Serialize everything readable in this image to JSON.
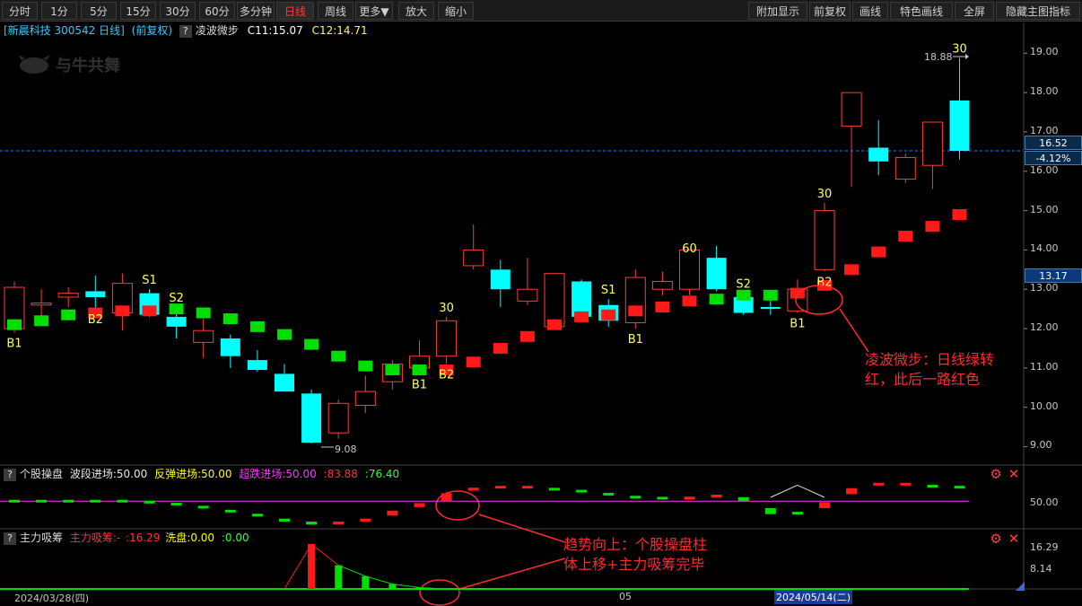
{
  "toolbar": {
    "left": [
      "分时",
      "1分",
      "5分",
      "15分",
      "30分",
      "60分",
      "多分钟",
      "日线",
      "周线",
      "更多▼",
      "放大",
      "缩小"
    ],
    "active": "日线",
    "right": [
      "附加显示",
      "前复权",
      "画线",
      "特色画线",
      "全屏",
      "隐藏主图指标"
    ]
  },
  "header": {
    "stock": "[新晨科技 300542 日线]",
    "adjust": "(前复权)",
    "indicator": "凌波微步",
    "c1": "C11:15.07",
    "c2": "C12:14.71"
  },
  "watermark": "与牛共舞",
  "price_axis": [
    "19.00",
    "18.00",
    "17.00",
    "16.00",
    "15.00",
    "14.00",
    "13.00",
    "12.00",
    "11.00",
    "10.00",
    "9.00"
  ],
  "price_tags": {
    "current": "16.52",
    "change": "-4.12%",
    "indicator": "13.17"
  },
  "markers": {
    "high": "18.88",
    "low": "9.08"
  },
  "chart_data": {
    "type": "candlestick",
    "y_range": [
      8.6,
      19.35
    ],
    "candles": [
      {
        "o": 12.0,
        "h": 13.2,
        "l": 11.9,
        "c": 13.05,
        "kind": "up"
      },
      {
        "o": 12.6,
        "h": 13.0,
        "l": 12.2,
        "c": 12.65,
        "kind": "up"
      },
      {
        "o": 12.8,
        "h": 13.05,
        "l": 12.55,
        "c": 12.9,
        "kind": "up"
      },
      {
        "o": 12.95,
        "h": 13.35,
        "l": 12.5,
        "c": 12.8,
        "kind": "down"
      },
      {
        "o": 12.4,
        "h": 13.4,
        "l": 11.95,
        "c": 13.15,
        "kind": "up"
      },
      {
        "o": 12.9,
        "h": 13.0,
        "l": 12.3,
        "c": 12.35,
        "kind": "down"
      },
      {
        "o": 12.3,
        "h": 12.55,
        "l": 11.75,
        "c": 12.05,
        "kind": "down"
      },
      {
        "o": 11.65,
        "h": 12.25,
        "l": 11.25,
        "c": 11.95,
        "kind": "up"
      },
      {
        "o": 11.75,
        "h": 11.85,
        "l": 11.0,
        "c": 11.3,
        "kind": "down"
      },
      {
        "o": 11.2,
        "h": 11.45,
        "l": 10.9,
        "c": 10.95,
        "kind": "down"
      },
      {
        "o": 10.85,
        "h": 11.1,
        "l": 10.4,
        "c": 10.4,
        "kind": "down"
      },
      {
        "o": 10.35,
        "h": 10.45,
        "l": 9.08,
        "c": 9.1,
        "kind": "down"
      },
      {
        "o": 9.35,
        "h": 10.2,
        "l": 9.2,
        "c": 10.1,
        "kind": "up"
      },
      {
        "o": 10.05,
        "h": 10.8,
        "l": 9.85,
        "c": 10.4,
        "kind": "up"
      },
      {
        "o": 10.65,
        "h": 11.2,
        "l": 10.45,
        "c": 11.1,
        "kind": "up"
      },
      {
        "o": 11.0,
        "h": 11.7,
        "l": 10.85,
        "c": 11.3,
        "kind": "up"
      },
      {
        "o": 11.3,
        "h": 12.3,
        "l": 11.1,
        "c": 12.2,
        "kind": "up"
      },
      {
        "o": 13.6,
        "h": 14.65,
        "l": 13.5,
        "c": 14.0,
        "kind": "up"
      },
      {
        "o": 13.5,
        "h": 13.75,
        "l": 12.55,
        "c": 13.0,
        "kind": "down"
      },
      {
        "o": 12.7,
        "h": 13.8,
        "l": 12.6,
        "c": 13.0,
        "kind": "up"
      },
      {
        "o": 12.05,
        "h": 13.4,
        "l": 12.05,
        "c": 13.4,
        "kind": "up"
      },
      {
        "o": 13.2,
        "h": 13.25,
        "l": 12.3,
        "c": 12.3,
        "kind": "down"
      },
      {
        "o": 12.6,
        "h": 12.75,
        "l": 12.05,
        "c": 12.2,
        "kind": "down"
      },
      {
        "o": 12.15,
        "h": 13.5,
        "l": 12.0,
        "c": 13.3,
        "kind": "up"
      },
      {
        "o": 13.0,
        "h": 13.45,
        "l": 12.85,
        "c": 13.2,
        "kind": "up"
      },
      {
        "o": 13.0,
        "h": 13.8,
        "l": 12.85,
        "c": 14.0,
        "kind": "up"
      },
      {
        "o": 13.8,
        "h": 14.1,
        "l": 12.95,
        "c": 13.0,
        "kind": "down"
      },
      {
        "o": 12.8,
        "h": 12.9,
        "l": 12.35,
        "c": 12.4,
        "kind": "down"
      },
      {
        "o": 12.55,
        "h": 12.9,
        "l": 12.35,
        "c": 12.5,
        "kind": "down"
      },
      {
        "o": 12.45,
        "h": 13.25,
        "l": 12.4,
        "c": 13.0,
        "kind": "up"
      },
      {
        "o": 13.5,
        "h": 15.2,
        "l": 13.45,
        "c": 15.0,
        "kind": "up"
      },
      {
        "o": 17.15,
        "h": 18.0,
        "l": 15.6,
        "c": 18.0,
        "kind": "up"
      },
      {
        "o": 16.6,
        "h": 17.3,
        "l": 15.9,
        "c": 16.25,
        "kind": "down"
      },
      {
        "o": 15.8,
        "h": 16.45,
        "l": 15.7,
        "c": 16.35,
        "kind": "up"
      },
      {
        "o": 16.15,
        "h": 17.25,
        "l": 15.55,
        "c": 17.25,
        "kind": "up"
      },
      {
        "o": 17.8,
        "h": 18.88,
        "l": 16.3,
        "c": 16.52,
        "kind": "down"
      }
    ],
    "step_line": [
      {
        "v": 12.1,
        "color": "green"
      },
      {
        "v": 12.2,
        "color": "green"
      },
      {
        "v": 12.35,
        "color": "green"
      },
      {
        "v": 12.4,
        "color": "red"
      },
      {
        "v": 12.45,
        "color": "red"
      },
      {
        "v": 12.45,
        "color": "red"
      },
      {
        "v": 12.5,
        "color": "green"
      },
      {
        "v": 12.4,
        "color": "green"
      },
      {
        "v": 12.25,
        "color": "green"
      },
      {
        "v": 12.05,
        "color": "green"
      },
      {
        "v": 11.85,
        "color": "green"
      },
      {
        "v": 11.6,
        "color": "green"
      },
      {
        "v": 11.3,
        "color": "green"
      },
      {
        "v": 11.05,
        "color": "green"
      },
      {
        "v": 10.95,
        "color": "green"
      },
      {
        "v": 10.95,
        "color": "green"
      },
      {
        "v": 10.95,
        "color": "red"
      },
      {
        "v": 11.15,
        "color": "red"
      },
      {
        "v": 11.5,
        "color": "red"
      },
      {
        "v": 11.8,
        "color": "red"
      },
      {
        "v": 12.1,
        "color": "red"
      },
      {
        "v": 12.3,
        "color": "red"
      },
      {
        "v": 12.35,
        "color": "red"
      },
      {
        "v": 12.45,
        "color": "red"
      },
      {
        "v": 12.55,
        "color": "red"
      },
      {
        "v": 12.7,
        "color": "red"
      },
      {
        "v": 12.75,
        "color": "green"
      },
      {
        "v": 12.85,
        "color": "green"
      },
      {
        "v": 12.85,
        "color": "green"
      },
      {
        "v": 12.9,
        "color": "red"
      },
      {
        "v": 13.1,
        "color": "red"
      },
      {
        "v": 13.5,
        "color": "red"
      },
      {
        "v": 13.95,
        "color": "red"
      },
      {
        "v": 14.35,
        "color": "red"
      },
      {
        "v": 14.6,
        "color": "red"
      },
      {
        "v": 14.9,
        "color": "red"
      }
    ],
    "signals": [
      {
        "i": 0,
        "text": "B1",
        "pos": "below"
      },
      {
        "i": 3,
        "text": "B2",
        "pos": "below"
      },
      {
        "i": 5,
        "text": "S1",
        "pos": "above"
      },
      {
        "i": 6,
        "text": "S2",
        "pos": "above"
      },
      {
        "i": 15,
        "text": "B1",
        "pos": "below"
      },
      {
        "i": 16,
        "text": "B2",
        "pos": "below"
      },
      {
        "i": 16,
        "text": "30",
        "pos": "above"
      },
      {
        "i": 22,
        "text": "S1",
        "pos": "above"
      },
      {
        "i": 23,
        "text": "B1",
        "pos": "below"
      },
      {
        "i": 25,
        "text": "60",
        "pos": "above"
      },
      {
        "i": 27,
        "text": "S2",
        "pos": "above"
      },
      {
        "i": 29,
        "text": "B1",
        "pos": "below"
      },
      {
        "i": 30,
        "text": "B2",
        "pos": "below"
      },
      {
        "i": 30,
        "text": "30",
        "pos": "above"
      },
      {
        "i": 35,
        "text": "30",
        "pos": "above"
      }
    ],
    "ind1": [
      {
        "v": 50,
        "d": 2,
        "c": "green"
      },
      {
        "v": 50,
        "d": 2,
        "c": "green"
      },
      {
        "v": 50,
        "d": 2,
        "c": "green"
      },
      {
        "v": 50,
        "d": 2,
        "c": "green"
      },
      {
        "v": 50,
        "d": 2,
        "c": "green"
      },
      {
        "v": 49,
        "d": 2,
        "c": "green"
      },
      {
        "v": 47,
        "d": 2,
        "c": "green"
      },
      {
        "v": 44,
        "d": 2,
        "c": "green"
      },
      {
        "v": 40,
        "d": 2,
        "c": "green"
      },
      {
        "v": 36,
        "d": 2,
        "c": "green"
      },
      {
        "v": 31,
        "d": 3,
        "c": "green"
      },
      {
        "v": 28,
        "d": 3,
        "c": "green"
      },
      {
        "v": 28,
        "d": 3,
        "c": "red"
      },
      {
        "v": 31,
        "d": 3,
        "c": "red"
      },
      {
        "v": 38,
        "d": 5,
        "c": "red"
      },
      {
        "v": 46,
        "d": 4,
        "c": "red"
      },
      {
        "v": 54,
        "d": 8,
        "c": "red"
      },
      {
        "v": 62,
        "d": 3,
        "c": "red"
      },
      {
        "v": 64,
        "d": 1,
        "c": "red"
      },
      {
        "v": 64,
        "d": 1,
        "c": "red"
      },
      {
        "v": 62,
        "d": 2,
        "c": "green"
      },
      {
        "v": 60,
        "d": 2,
        "c": "green"
      },
      {
        "v": 57,
        "d": 2,
        "c": "green"
      },
      {
        "v": 54,
        "d": 2,
        "c": "green"
      },
      {
        "v": 53,
        "d": 2,
        "c": "green"
      },
      {
        "v": 53,
        "d": 3,
        "c": "red"
      },
      {
        "v": 55,
        "d": 3,
        "c": "red"
      },
      {
        "v": 52,
        "d": 4,
        "c": "green"
      },
      {
        "v": 40,
        "d": 6,
        "c": "green"
      },
      {
        "v": 38,
        "d": 1,
        "c": "green"
      },
      {
        "v": 46,
        "d": 6,
        "c": "red"
      },
      {
        "v": 60,
        "d": 6,
        "c": "red"
      },
      {
        "v": 67,
        "d": 2,
        "c": "red"
      },
      {
        "v": 67,
        "d": 1,
        "c": "red"
      },
      {
        "v": 65,
        "d": 2,
        "c": "green"
      },
      {
        "v": 64,
        "d": 1,
        "c": "green"
      }
    ],
    "ind2": [
      0,
      0,
      0,
      0,
      0,
      0,
      0,
      0,
      0,
      0,
      0,
      16.29,
      8.6,
      4.6,
      1.8,
      0.5,
      0,
      0,
      0,
      0,
      0,
      0,
      0,
      0,
      0,
      0,
      0,
      0,
      0,
      0,
      0,
      0,
      0,
      0,
      0,
      0
    ],
    "ind2_colors": [
      "",
      "",
      "",
      "",
      "",
      "",
      "",
      "",
      "",
      "",
      "",
      "red",
      "green",
      "green",
      "green",
      "green",
      "",
      "",
      "",
      "",
      "",
      "",
      "",
      "",
      "",
      "",
      "",
      "",
      "",
      "",
      "",
      "",
      "",
      "",
      "",
      ""
    ]
  },
  "panel1": {
    "name": "个股操盘",
    "items": [
      {
        "label": "波段进场:50.00",
        "color": "#e8e8e8"
      },
      {
        "label": "反弹进场:50.00",
        "color": "#ffff00"
      },
      {
        "label": "超跌进场:50.00",
        "color": "#ff33ff"
      },
      {
        "label": ":83.88",
        "color": "#ff3333"
      },
      {
        "label": ":76.40",
        "color": "#33ff33"
      }
    ],
    "axis": "50.00"
  },
  "panel2": {
    "name": "主力吸筹",
    "items": [
      {
        "label": "主力吸筹:-",
        "color": "#ff3333"
      },
      {
        "label": ":16.29",
        "color": "#ff3333"
      },
      {
        "label": "洗盘:0.00",
        "color": "#ffff00"
      },
      {
        "label": ":0.00",
        "color": "#33ff33"
      }
    ],
    "axis_top": "16.29",
    "axis_mid": "8.14"
  },
  "date_axis": {
    "left": "2024/03/28(四)",
    "mid": "05",
    "highlight": "2024/05/14(二)"
  },
  "annotations": {
    "a1_line1": "凌波微步：日线绿转",
    "a1_line2": "红，此后一路红色",
    "a2_line1": "趋势向上：个股操盘柱",
    "a2_line2": "体上移+主力吸筹完毕"
  },
  "colors": {
    "up": "#ff3b3b",
    "down": "#00ffff",
    "green": "#00e000",
    "red": "#ff1a1a",
    "signal": "#ffff55",
    "magenta": "#ff33ff"
  }
}
